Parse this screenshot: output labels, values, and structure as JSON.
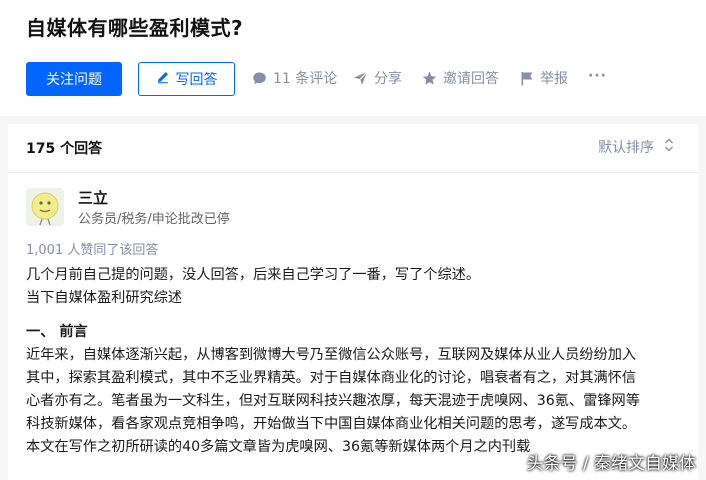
{
  "question": {
    "title": "自媒体有哪些盈利模式?"
  },
  "toolbar": {
    "follow_label": "关注问题",
    "write_label": "写回答",
    "comments_label": "11 条评论",
    "share_label": "分享",
    "invite_label": "邀请回答",
    "report_label": "举报",
    "more_label": "···"
  },
  "answers": {
    "count_label": "175 个回答",
    "sort_label": "默认排序"
  },
  "answer": {
    "author": "三立",
    "headline": "公务员/税务/申论批改已停",
    "votes_label": "1,001 人赞同了该回答",
    "lines": [
      "几个月前自己提的问题，没人回答，后来自己学习了一番，写了个综述。",
      "当下自媒体盈利研究综述"
    ],
    "section_title": "一、 前言",
    "section_lines": [
      "近年来，自媒体逐渐兴起，从博客到微博大号乃至微信公众账号，互联网及媒体从业人员纷纷加入",
      "其中，探索其盈利模式，其中不乏业界精英。对于自媒体商业化的讨论，唱衰者有之，对其满怀信",
      "心者亦有之。笔者虽为一文科生，但对互联网科技兴趣浓厚，每天混迹于虎嗅网、36氪、雷锋网等",
      "科技新媒体，看各家观点竞相争鸣，开始做当下中国自媒体商业化相关问题的思考，遂写成本文。",
      "本文在写作之初所研读的40多篇文章皆为虎嗅网、36氪等新媒体两个月之内刊载"
    ]
  },
  "watermark": "头条号 / 秦绪文自媒体",
  "colors": {
    "primary": "#0066ff",
    "muted": "#8590a6",
    "background": "#f6f6f6"
  },
  "icons": [
    "pen-icon",
    "comment-icon",
    "share-icon",
    "star-icon",
    "flag-icon",
    "more-icon",
    "sort-icon",
    "avatar"
  ]
}
